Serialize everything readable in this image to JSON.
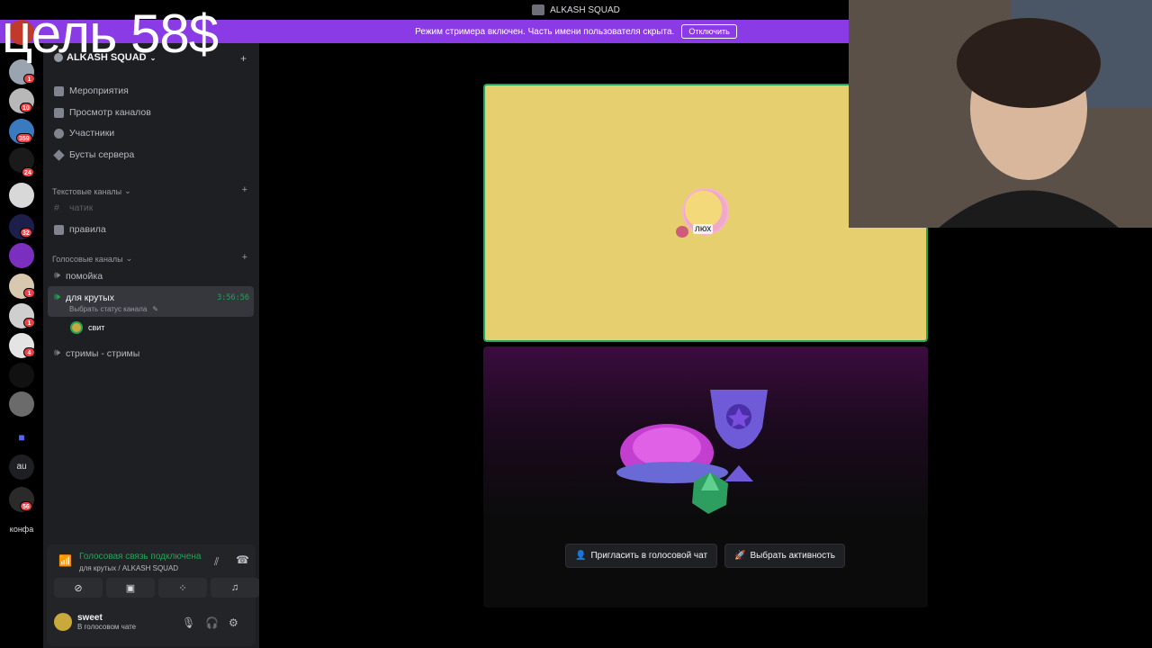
{
  "window": {
    "title": "ALKASH SQUAD"
  },
  "overlay": {
    "goal_text": "цель 58$"
  },
  "banner": {
    "message": "Режим стримера включен. Часть имени пользователя скрыта.",
    "button": "Отключить"
  },
  "guild_rail": {
    "badges": [
      "1",
      "10",
      "359",
      "24",
      "32",
      "1",
      "1",
      "4",
      "56"
    ],
    "text_icons": [
      "au",
      "конфа"
    ]
  },
  "sidebar": {
    "server_name": "ALKASH SQUAD",
    "menu": [
      "Мероприятия",
      "Просмотр каналов",
      "Участники",
      "Бусты сервера"
    ],
    "text_category": "Текстовые каналы",
    "text_channels": [
      "чатик",
      "правила"
    ],
    "voice_category": "Голосовые каналы",
    "voice_channels": [
      "помойка",
      "для крутых",
      "стримы - стримы"
    ],
    "active_channel_timer": "3:56:56",
    "active_channel_status": "Выбрать статус канала",
    "voice_member": "свит"
  },
  "voice_panel": {
    "status": "Голосовая связь подключена",
    "location": "для крутых / ALKASH SQUAD",
    "user": {
      "name": "sweet",
      "status": "В голосовом чате"
    }
  },
  "main": {
    "avatar_label": "люх",
    "invite_button": "Пригласить в голосовой чат",
    "activity_button": "Выбрать активность"
  },
  "colors": {
    "banner": "#8a3be6",
    "speaking_green": "#23a55a",
    "tile_yellow": "#e6cf6f",
    "badge_red": "#f23f43"
  }
}
